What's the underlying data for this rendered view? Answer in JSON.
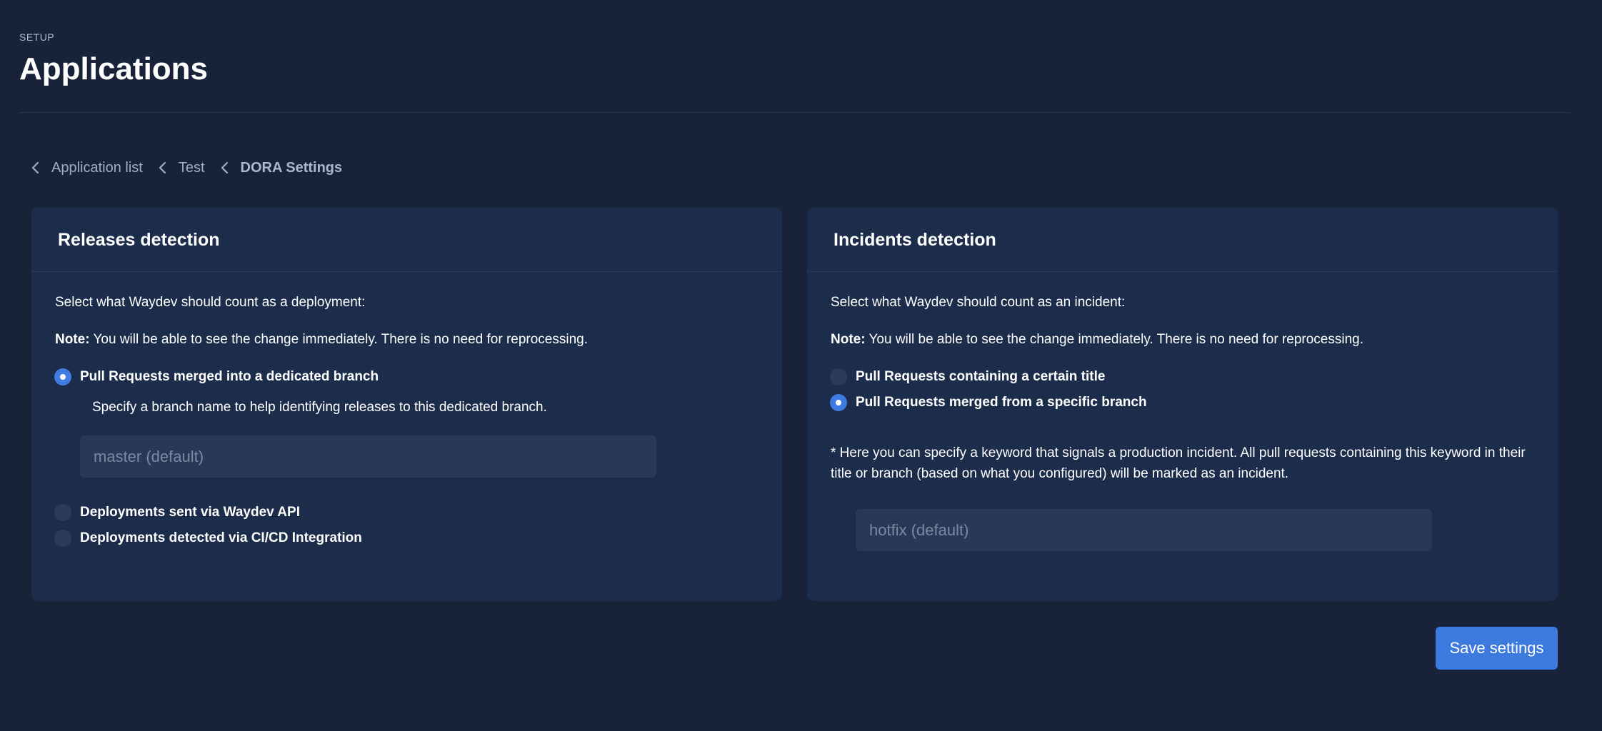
{
  "header": {
    "eyebrow": "SETUP",
    "title": "Applications"
  },
  "breadcrumb": [
    {
      "label": "Application list",
      "icon": "chevron-left-icon"
    },
    {
      "label": "Test",
      "icon": "chevron-left-icon"
    },
    {
      "label": "DORA Settings",
      "icon": "chevron-left-icon"
    }
  ],
  "releases": {
    "title": "Releases detection",
    "prompt": "Select what Waydev should count as a deployment:",
    "note_label": "Note:",
    "note_text": " You will be able to see the change immediately. There is no need for reprocessing.",
    "options": [
      {
        "label": "Pull Requests merged into a dedicated branch",
        "checked": true
      },
      {
        "label": "Deployments sent via Waydev API",
        "checked": false
      },
      {
        "label": "Deployments detected via CI/CD Integration",
        "checked": false
      }
    ],
    "branch_hint": "Specify a branch name to help identifying releases to this dedicated branch.",
    "branch_input": {
      "value": "",
      "placeholder": "master (default)"
    }
  },
  "incidents": {
    "title": "Incidents detection",
    "prompt": "Select what Waydev should count as an incident:",
    "note_label": "Note:",
    "note_text": " You will be able to see the change immediately. There is no need for reprocessing.",
    "options": [
      {
        "label": "Pull Requests containing a certain title",
        "checked": false
      },
      {
        "label": "Pull Requests merged from a specific branch",
        "checked": true
      }
    ],
    "keyword_hint": "* Here you can specify a keyword that signals a production incident. All pull requests containing this keyword in their title or branch (based on what you configured) will be marked as an incident.",
    "keyword_input": {
      "value": "",
      "placeholder": "hotfix (default)"
    }
  },
  "actions": {
    "save_label": "Save settings"
  },
  "colors": {
    "background": "#18233a",
    "card": "#1c2c4b",
    "accent": "#3d7ae0"
  }
}
